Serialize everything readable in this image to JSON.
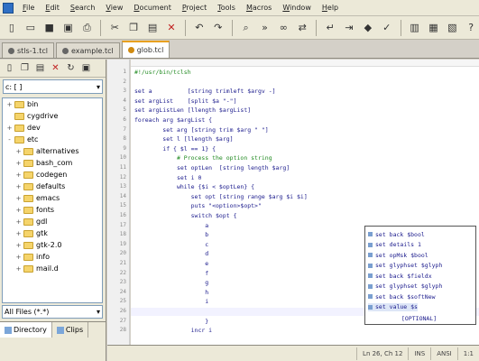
{
  "menu": {
    "items": [
      {
        "label": "File",
        "underline": "F",
        "rest": "ile"
      },
      {
        "label": "Edit",
        "underline": "E",
        "rest": "dit"
      },
      {
        "label": "Search",
        "underline": "S",
        "rest": "earch"
      },
      {
        "label": "View",
        "underline": "V",
        "rest": "iew"
      },
      {
        "label": "Document",
        "underline": "D",
        "rest": "ocument"
      },
      {
        "label": "Project",
        "underline": "P",
        "rest": "roject"
      },
      {
        "label": "Tools",
        "underline": "T",
        "rest": "ools"
      },
      {
        "label": "Macros",
        "underline": "M",
        "rest": "acros"
      },
      {
        "label": "Window",
        "underline": "W",
        "rest": "indow"
      },
      {
        "label": "Help",
        "underline": "H",
        "rest": "elp"
      }
    ]
  },
  "tabs": [
    {
      "label": "stls-1.tcl",
      "active": false
    },
    {
      "label": "example.tcl",
      "active": false
    },
    {
      "label": "glob.tcl",
      "active": true
    }
  ],
  "file_panel": {
    "drive": "c: [ ]",
    "filter": "All Files (*.*)",
    "tree": [
      {
        "label": "bin",
        "expander": "+"
      },
      {
        "label": "cygdrive",
        "expander": ""
      },
      {
        "label": "dev",
        "expander": "+"
      },
      {
        "label": "etc",
        "expander": "-"
      },
      {
        "label": "alternatives",
        "expander": "+",
        "indent": true
      },
      {
        "label": "bash_com",
        "expander": "+",
        "indent": true
      },
      {
        "label": "codegen",
        "expander": "+",
        "indent": true
      },
      {
        "label": "defaults",
        "expander": "+",
        "indent": true
      },
      {
        "label": "emacs",
        "expander": "+",
        "indent": true
      },
      {
        "label": "fonts",
        "expander": "+",
        "indent": true
      },
      {
        "label": "gdl",
        "expander": "+",
        "indent": true
      },
      {
        "label": "gtk",
        "expander": "+",
        "indent": true
      },
      {
        "label": "gtk-2.0",
        "expander": "+",
        "indent": true
      },
      {
        "label": "info",
        "expander": "+",
        "indent": true
      },
      {
        "label": "mail.d",
        "expander": "+",
        "indent": true
      }
    ],
    "bottom_tabs": [
      "Directory",
      "Clips"
    ]
  },
  "editor": {
    "line_numbers": [
      "1",
      "2",
      "3",
      "4",
      "5",
      "6",
      "7",
      "8",
      "9",
      "10",
      "11",
      "12",
      "13",
      "14",
      "15",
      "16",
      "17",
      "18",
      "19",
      "20",
      "21",
      "22",
      "23",
      "24",
      "25",
      "26",
      "27",
      "28"
    ],
    "lines": [
      {
        "text": "#!/usr/bin/tclsh",
        "cls": "comment"
      },
      {
        "text": ""
      },
      {
        "text": "set a          [string trimleft $argv -]"
      },
      {
        "text": "set argList    [split $a \"-\"]"
      },
      {
        "text": "set argListLen [llength $argList]"
      },
      {
        "text": "foreach arg $argList {"
      },
      {
        "text": "        set arg [string trim $arg \" \"]"
      },
      {
        "text": "        set l [llength $arg]"
      },
      {
        "text": "        if { $l == 1} {"
      },
      {
        "text": "            # Process the option string",
        "cls": "comment"
      },
      {
        "text": "            set optLen  [string length $arg]"
      },
      {
        "text": "            set i 0"
      },
      {
        "text": "            while {$i < $optLen} {"
      },
      {
        "text": "                set opt [string range $arg $i $i]"
      },
      {
        "text": "                puts \"<option>$opt>\""
      },
      {
        "text": "                switch $opt {"
      },
      {
        "text": "                    a"
      },
      {
        "text": "                    b"
      },
      {
        "text": "                    c"
      },
      {
        "text": "                    d"
      },
      {
        "text": "                    e"
      },
      {
        "text": "                    f"
      },
      {
        "text": "                    g"
      },
      {
        "text": "                    h"
      },
      {
        "text": "                    i"
      },
      {
        "text": ""
      },
      {
        "text": "                    }"
      },
      {
        "text": "                incr i"
      }
    ]
  },
  "autocomplete": {
    "items": [
      "set back $bool",
      "set details 1",
      "set opMsk $bool",
      "set glyphset $glyph",
      "set back $fieldx",
      "set glyphset $glyph",
      "set back $softNew",
      "set value $s"
    ],
    "selected_index": 7,
    "hint": "[OPTIONAL]"
  },
  "status": {
    "position": "Ln 26, Ch 12",
    "mode": "INS",
    "encoding": "ANSI",
    "lines_total": "1:1"
  }
}
